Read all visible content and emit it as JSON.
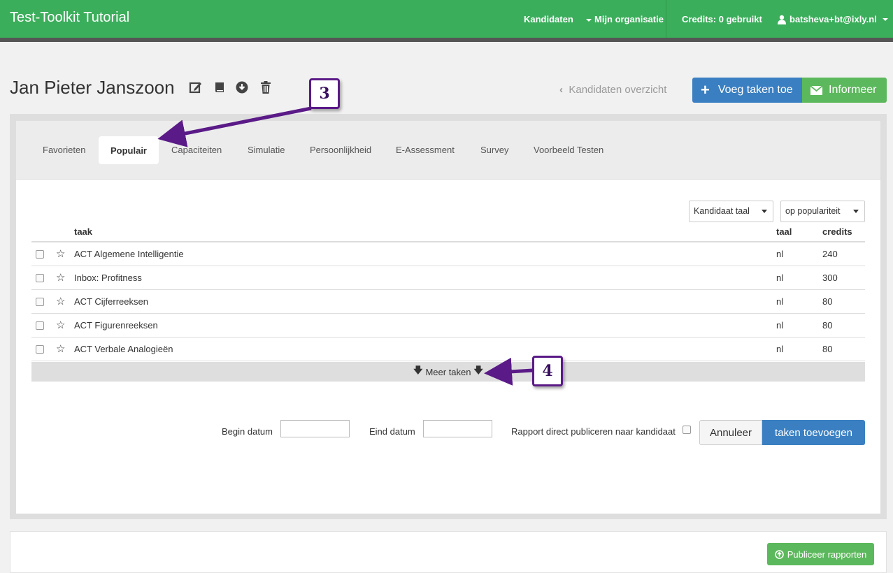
{
  "navbar": {
    "brand": "Test-Toolkit Tutorial",
    "links": {
      "kandidaten": "Kandidaten",
      "organisatie": "Mijn organisatie",
      "credits": "Credits: 0 gebruikt",
      "user": "batsheva+bt@ixly.nl"
    },
    "color": "#3bae5b"
  },
  "header": {
    "title": "Jan Pieter Janszoon",
    "icons": [
      "edit-icon",
      "book-icon",
      "download-icon",
      "trash-icon"
    ],
    "back_label": "Kandidaten overzicht",
    "add_tasks_label": "Voeg taken toe",
    "inform_label": "Informeer"
  },
  "tabs": [
    {
      "label": "Favorieten"
    },
    {
      "label": "Populair",
      "active": true
    },
    {
      "label": "Capaciteiten"
    },
    {
      "label": "Simulatie"
    },
    {
      "label": "Persoonlijkheid"
    },
    {
      "label": "E-Assessment"
    },
    {
      "label": "Survey"
    },
    {
      "label": "Voorbeeld Testen"
    }
  ],
  "filters": {
    "language": "Kandidaat taal",
    "sort": "op populariteit"
  },
  "table": {
    "columns": {
      "task": "taak",
      "language": "taal",
      "credits": "credits"
    },
    "rows": [
      {
        "name": "ACT Algemene Intelligentie",
        "language": "nl",
        "credits": "240"
      },
      {
        "name": "Inbox: Profitness",
        "language": "nl",
        "credits": "300"
      },
      {
        "name": "ACT Cijferreeksen",
        "language": "nl",
        "credits": "80"
      },
      {
        "name": "ACT Figurenreeksen",
        "language": "nl",
        "credits": "80"
      },
      {
        "name": "ACT Verbale Analogieën",
        "language": "nl",
        "credits": "80"
      }
    ],
    "more_label": "Meer taken"
  },
  "form": {
    "start_label": "Begin datum",
    "start_value": "",
    "end_label": "Eind datum",
    "end_value": "",
    "publish_label": "Rapport direct publiceren naar kandidaat",
    "cancel_label": "Annuleer",
    "submit_label": "taken toevoegen"
  },
  "footer": {
    "publish_reports_label": "Publiceer rapporten"
  },
  "callouts": {
    "three": "3",
    "four": "4"
  },
  "colors": {
    "primary": "#3a7fc1",
    "success": "#5cb85c",
    "callout_border": "#5a1a87"
  }
}
